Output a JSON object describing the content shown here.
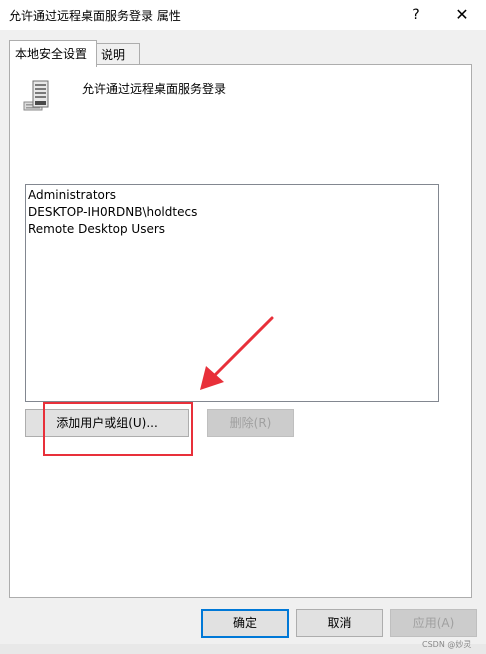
{
  "window": {
    "title": "允许通过远程桌面服务登录 属性",
    "help_glyph": "?",
    "close_glyph": "✕"
  },
  "tabs": [
    {
      "label": "本地安全设置"
    },
    {
      "label": "说明"
    }
  ],
  "policy": {
    "icon": "server-policy-icon",
    "name": "允许通过远程桌面服务登录"
  },
  "members": [
    "Administrators",
    "DESKTOP-IH0RDNB\\holdtecs",
    "Remote Desktop Users"
  ],
  "buttons": {
    "add": "添加用户或组(U)...",
    "remove": "删除(R)",
    "ok": "确定",
    "cancel": "取消",
    "apply": "应用(A)"
  },
  "annotation": {
    "color": "#e8303a"
  },
  "watermark": "CSDN @妙灵"
}
